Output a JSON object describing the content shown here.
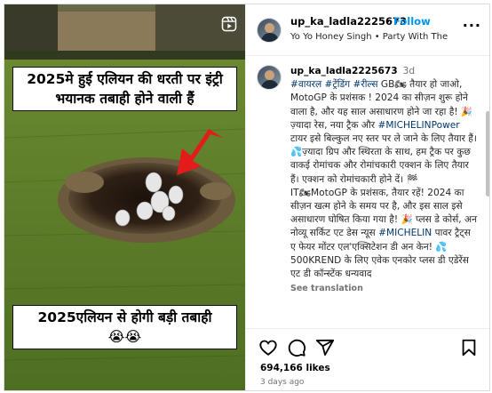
{
  "media": {
    "caption_top": "2025मे हुई एलियन की धरती पर इंट्री भयानक तबाही होने वाली हैं",
    "caption_bottom": "2025एलियन से होगी बड़ी तबाही",
    "caption_bottom_emoji": "😭😭",
    "reel_icon": "reels-icon"
  },
  "header": {
    "username": "up_ka_ladla2225673",
    "separator": "•",
    "follow_label": "Follow",
    "music": "Yo Yo Honey Singh • Party With The Bho...",
    "more_label": "..."
  },
  "post": {
    "username": "up_ka_ladla2225673",
    "time": "3d",
    "text_1": "#वायरल #ट्रेंडिंग #रील्स",
    "text_2": " GB🏍 तैयार हो जाओ, MotoGP के प्रशंसक ! 2024 का सीज़न शुरू होने वाला है, और यह साल असाधारण होने जा रहा है! 🎉ज़्यादा रेस, नया ट्रैक और ",
    "tag_michelin": "#MICHELINPower",
    "text_3": " टायर इसे बिल्कुल नए स्तर पर ले जाने के लिए तैयार हैं। 💦ज़्यादा ग्रिप और स्थिरता के साथ, हम ट्रैक पर कुछ वाकई रोमांचक और रोमांचकारी एक्शन के लिए तैयार हैं। एक्शन को रोमांचकारी होने दें। 🏁",
    "text_4": "IT🏍MotoGP के प्रशंसक, तैयार रहें! 2024 का सीज़न खत्म होने के समय पर है, और इस साल इसे असाधारण घोषित किया गया है! 🎉 प्लस डे कोर्स, अन नोव्यू सर्किट एट डेस न्यूस ",
    "tag_michelin2": "#MICHELIN",
    "text_5": " पावर ट्रैट्स ए फेयर मोंटर एल'एक्सिटेशन डी अन केन! 💦 500KREND के लिए एवेक एनकोर प्लस डी एडेरेंस एट डी कॉन्स्टेंक धन्यवाद",
    "see_translation": "See translation"
  },
  "actions": {
    "likes": "694,166 likes",
    "ago": "3 days ago",
    "like_icon": "heart-icon",
    "comment_icon": "comment-icon",
    "share_icon": "share-icon",
    "save_icon": "bookmark-icon"
  }
}
